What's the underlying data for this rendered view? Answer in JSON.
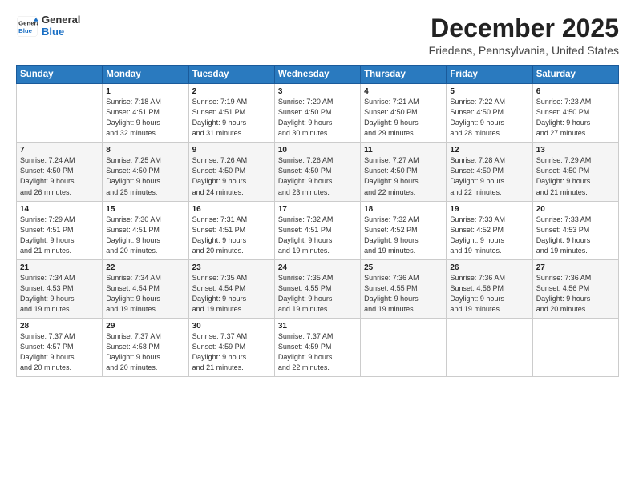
{
  "header": {
    "logo_line1": "General",
    "logo_line2": "Blue",
    "title": "December 2025",
    "subtitle": "Friedens, Pennsylvania, United States"
  },
  "weekdays": [
    "Sunday",
    "Monday",
    "Tuesday",
    "Wednesday",
    "Thursday",
    "Friday",
    "Saturday"
  ],
  "weeks": [
    [
      {
        "day": "",
        "info": ""
      },
      {
        "day": "1",
        "info": "Sunrise: 7:18 AM\nSunset: 4:51 PM\nDaylight: 9 hours\nand 32 minutes."
      },
      {
        "day": "2",
        "info": "Sunrise: 7:19 AM\nSunset: 4:51 PM\nDaylight: 9 hours\nand 31 minutes."
      },
      {
        "day": "3",
        "info": "Sunrise: 7:20 AM\nSunset: 4:50 PM\nDaylight: 9 hours\nand 30 minutes."
      },
      {
        "day": "4",
        "info": "Sunrise: 7:21 AM\nSunset: 4:50 PM\nDaylight: 9 hours\nand 29 minutes."
      },
      {
        "day": "5",
        "info": "Sunrise: 7:22 AM\nSunset: 4:50 PM\nDaylight: 9 hours\nand 28 minutes."
      },
      {
        "day": "6",
        "info": "Sunrise: 7:23 AM\nSunset: 4:50 PM\nDaylight: 9 hours\nand 27 minutes."
      }
    ],
    [
      {
        "day": "7",
        "info": "Sunrise: 7:24 AM\nSunset: 4:50 PM\nDaylight: 9 hours\nand 26 minutes."
      },
      {
        "day": "8",
        "info": "Sunrise: 7:25 AM\nSunset: 4:50 PM\nDaylight: 9 hours\nand 25 minutes."
      },
      {
        "day": "9",
        "info": "Sunrise: 7:26 AM\nSunset: 4:50 PM\nDaylight: 9 hours\nand 24 minutes."
      },
      {
        "day": "10",
        "info": "Sunrise: 7:26 AM\nSunset: 4:50 PM\nDaylight: 9 hours\nand 23 minutes."
      },
      {
        "day": "11",
        "info": "Sunrise: 7:27 AM\nSunset: 4:50 PM\nDaylight: 9 hours\nand 22 minutes."
      },
      {
        "day": "12",
        "info": "Sunrise: 7:28 AM\nSunset: 4:50 PM\nDaylight: 9 hours\nand 22 minutes."
      },
      {
        "day": "13",
        "info": "Sunrise: 7:29 AM\nSunset: 4:50 PM\nDaylight: 9 hours\nand 21 minutes."
      }
    ],
    [
      {
        "day": "14",
        "info": "Sunrise: 7:29 AM\nSunset: 4:51 PM\nDaylight: 9 hours\nand 21 minutes."
      },
      {
        "day": "15",
        "info": "Sunrise: 7:30 AM\nSunset: 4:51 PM\nDaylight: 9 hours\nand 20 minutes."
      },
      {
        "day": "16",
        "info": "Sunrise: 7:31 AM\nSunset: 4:51 PM\nDaylight: 9 hours\nand 20 minutes."
      },
      {
        "day": "17",
        "info": "Sunrise: 7:32 AM\nSunset: 4:51 PM\nDaylight: 9 hours\nand 19 minutes."
      },
      {
        "day": "18",
        "info": "Sunrise: 7:32 AM\nSunset: 4:52 PM\nDaylight: 9 hours\nand 19 minutes."
      },
      {
        "day": "19",
        "info": "Sunrise: 7:33 AM\nSunset: 4:52 PM\nDaylight: 9 hours\nand 19 minutes."
      },
      {
        "day": "20",
        "info": "Sunrise: 7:33 AM\nSunset: 4:53 PM\nDaylight: 9 hours\nand 19 minutes."
      }
    ],
    [
      {
        "day": "21",
        "info": "Sunrise: 7:34 AM\nSunset: 4:53 PM\nDaylight: 9 hours\nand 19 minutes."
      },
      {
        "day": "22",
        "info": "Sunrise: 7:34 AM\nSunset: 4:54 PM\nDaylight: 9 hours\nand 19 minutes."
      },
      {
        "day": "23",
        "info": "Sunrise: 7:35 AM\nSunset: 4:54 PM\nDaylight: 9 hours\nand 19 minutes."
      },
      {
        "day": "24",
        "info": "Sunrise: 7:35 AM\nSunset: 4:55 PM\nDaylight: 9 hours\nand 19 minutes."
      },
      {
        "day": "25",
        "info": "Sunrise: 7:36 AM\nSunset: 4:55 PM\nDaylight: 9 hours\nand 19 minutes."
      },
      {
        "day": "26",
        "info": "Sunrise: 7:36 AM\nSunset: 4:56 PM\nDaylight: 9 hours\nand 19 minutes."
      },
      {
        "day": "27",
        "info": "Sunrise: 7:36 AM\nSunset: 4:56 PM\nDaylight: 9 hours\nand 20 minutes."
      }
    ],
    [
      {
        "day": "28",
        "info": "Sunrise: 7:37 AM\nSunset: 4:57 PM\nDaylight: 9 hours\nand 20 minutes."
      },
      {
        "day": "29",
        "info": "Sunrise: 7:37 AM\nSunset: 4:58 PM\nDaylight: 9 hours\nand 20 minutes."
      },
      {
        "day": "30",
        "info": "Sunrise: 7:37 AM\nSunset: 4:59 PM\nDaylight: 9 hours\nand 21 minutes."
      },
      {
        "day": "31",
        "info": "Sunrise: 7:37 AM\nSunset: 4:59 PM\nDaylight: 9 hours\nand 22 minutes."
      },
      {
        "day": "",
        "info": ""
      },
      {
        "day": "",
        "info": ""
      },
      {
        "day": "",
        "info": ""
      }
    ]
  ]
}
